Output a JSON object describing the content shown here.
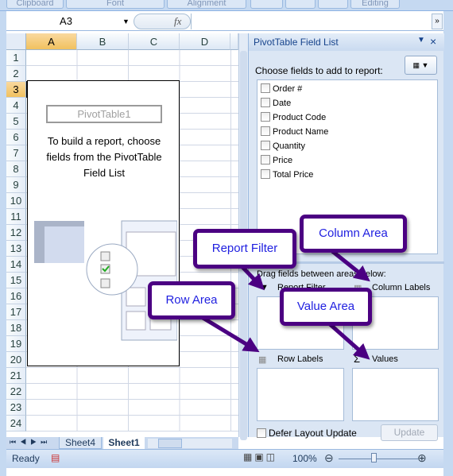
{
  "ribbon": {
    "groups": [
      "Clipboard",
      "Font",
      "Alignment",
      "",
      "",
      "",
      "Editing"
    ]
  },
  "formula_bar": {
    "name_box": "A3",
    "fx": "fx",
    "value": ""
  },
  "columns": [
    "A",
    "B",
    "C",
    "D"
  ],
  "rows": [
    "1",
    "2",
    "3",
    "4",
    "5",
    "6",
    "7",
    "8",
    "9",
    "10",
    "11",
    "12",
    "13",
    "14",
    "15",
    "16",
    "17",
    "18",
    "19",
    "20",
    "21",
    "22",
    "23",
    "24"
  ],
  "selected_cell": "A3",
  "pivot_placeholder": {
    "name": "PivotTable1",
    "instruction": "To build a report, choose fields from the PivotTable Field List"
  },
  "field_list": {
    "title": "PivotTable Field List",
    "choose_label": "Choose fields to add to report:",
    "fields": [
      "Order #",
      "Date",
      "Product Code",
      "Product Name",
      "Quantity",
      "Price",
      "Total Price"
    ],
    "drag_label": "Drag fields between areas below:",
    "areas": {
      "report_filter": "Report Filter",
      "column_labels": "Column Labels",
      "row_labels": "Row Labels",
      "values": "Values"
    },
    "defer_label": "Defer Layout Update",
    "update_button": "Update"
  },
  "sheet_tabs": [
    "Sheet4",
    "Sheet1"
  ],
  "active_sheet": "Sheet1",
  "status": {
    "ready": "Ready",
    "zoom": "100%"
  },
  "callouts": {
    "report_filter": "Report Filter",
    "column_area": "Column Area",
    "row_area": "Row Area",
    "value_area": "Value Area"
  },
  "colors": {
    "callout_border": "#4b0082",
    "callout_text": "#1f1fe0",
    "panel_bg": "#dbe6f4"
  }
}
